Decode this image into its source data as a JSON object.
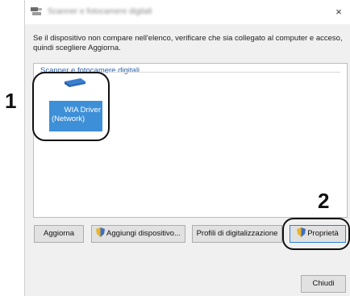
{
  "window": {
    "title": "Scanner e fotocamere digitali",
    "close_glyph": "×"
  },
  "instruction": "Se il dispositivo non compare nell'elenco, verificare che sia collegato al computer e acceso, quindi scegliere Aggiorna.",
  "group": {
    "label": "Scanner e fotocamere digitali",
    "devices": [
      {
        "line1": "WIA Driver",
        "line2": "(Network)",
        "icon": "scanner-icon"
      }
    ]
  },
  "buttons": {
    "refresh": "Aggiorna",
    "add_device": "Aggiungi dispositivo...",
    "scan_profiles": "Profili di digitalizzazione",
    "properties": "Proprietà",
    "close": "Chiudi"
  },
  "callouts": {
    "one": "1",
    "two": "2"
  },
  "colors": {
    "tile": "#3d8fd8",
    "group_label": "#2d5fa8",
    "focus_border": "#2f7fd6"
  }
}
